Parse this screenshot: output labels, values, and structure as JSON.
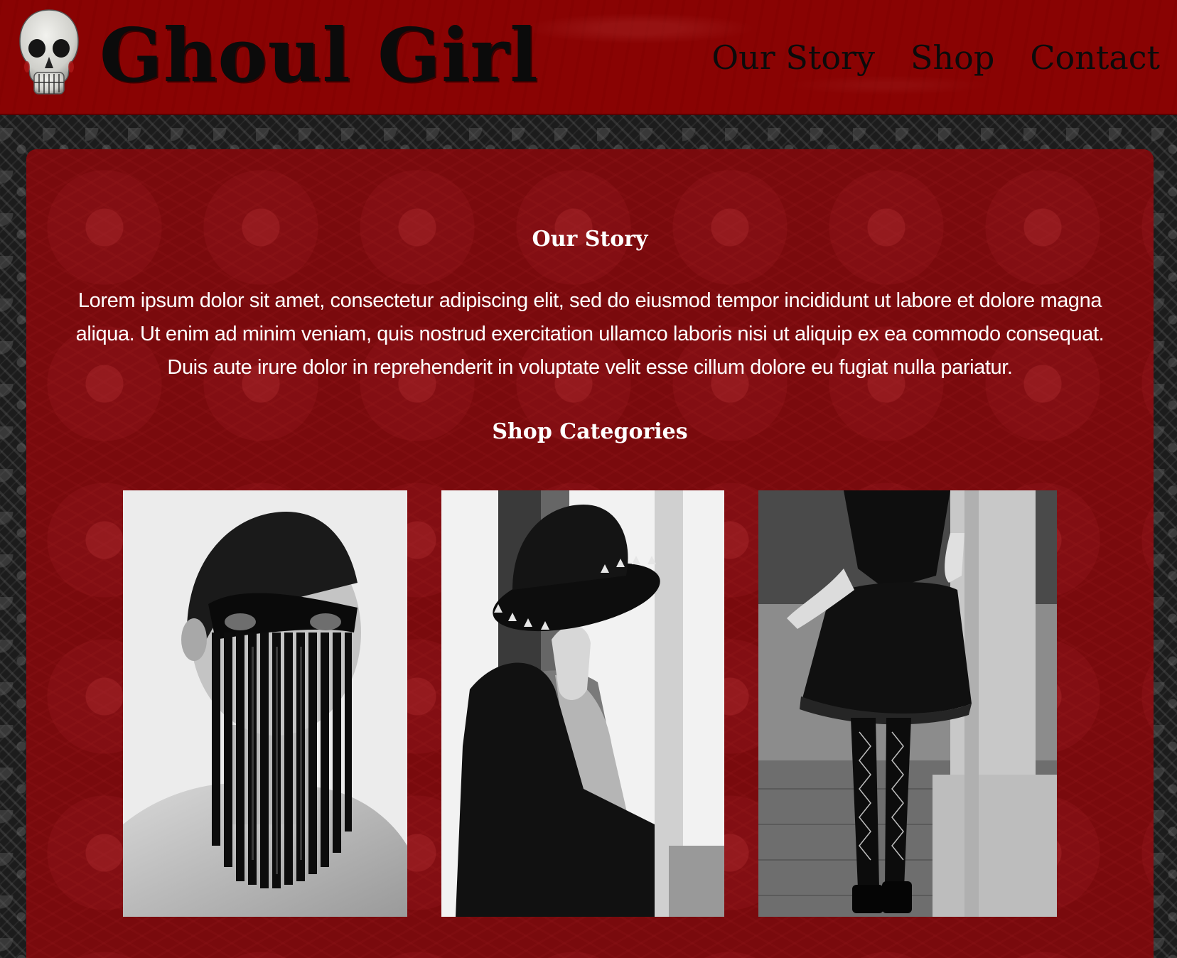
{
  "header": {
    "title": "Ghoul Girl",
    "logo_icon": "skull-icon",
    "nav": [
      {
        "label": "Our Story"
      },
      {
        "label": "Shop"
      },
      {
        "label": "Contact"
      }
    ]
  },
  "main": {
    "story_heading": "Our Story",
    "story_text": "Lorem ipsum dolor sit amet, consectetur adipiscing elit, sed do eiusmod tempor incididunt ut labore et dolore magna aliqua. Ut enim ad minim veniam, quis nostrud exercitation ullamco laboris nisi ut aliquip ex ea commodo consequat. Duis aute irure dolor in reprehenderit in voluptate velit esse cillum dolore eu fugiat nulla pariatur.",
    "shop_heading": "Shop Categories",
    "categories": [
      {
        "image": "fringe-mask-photo"
      },
      {
        "image": "studded-hat-photo"
      },
      {
        "image": "black-dress-photo"
      }
    ]
  },
  "colors": {
    "header_red": "#8a0303",
    "panel_red": "#7a0a0d",
    "text_white": "#ffffff",
    "title_black": "#0b0b0b"
  }
}
